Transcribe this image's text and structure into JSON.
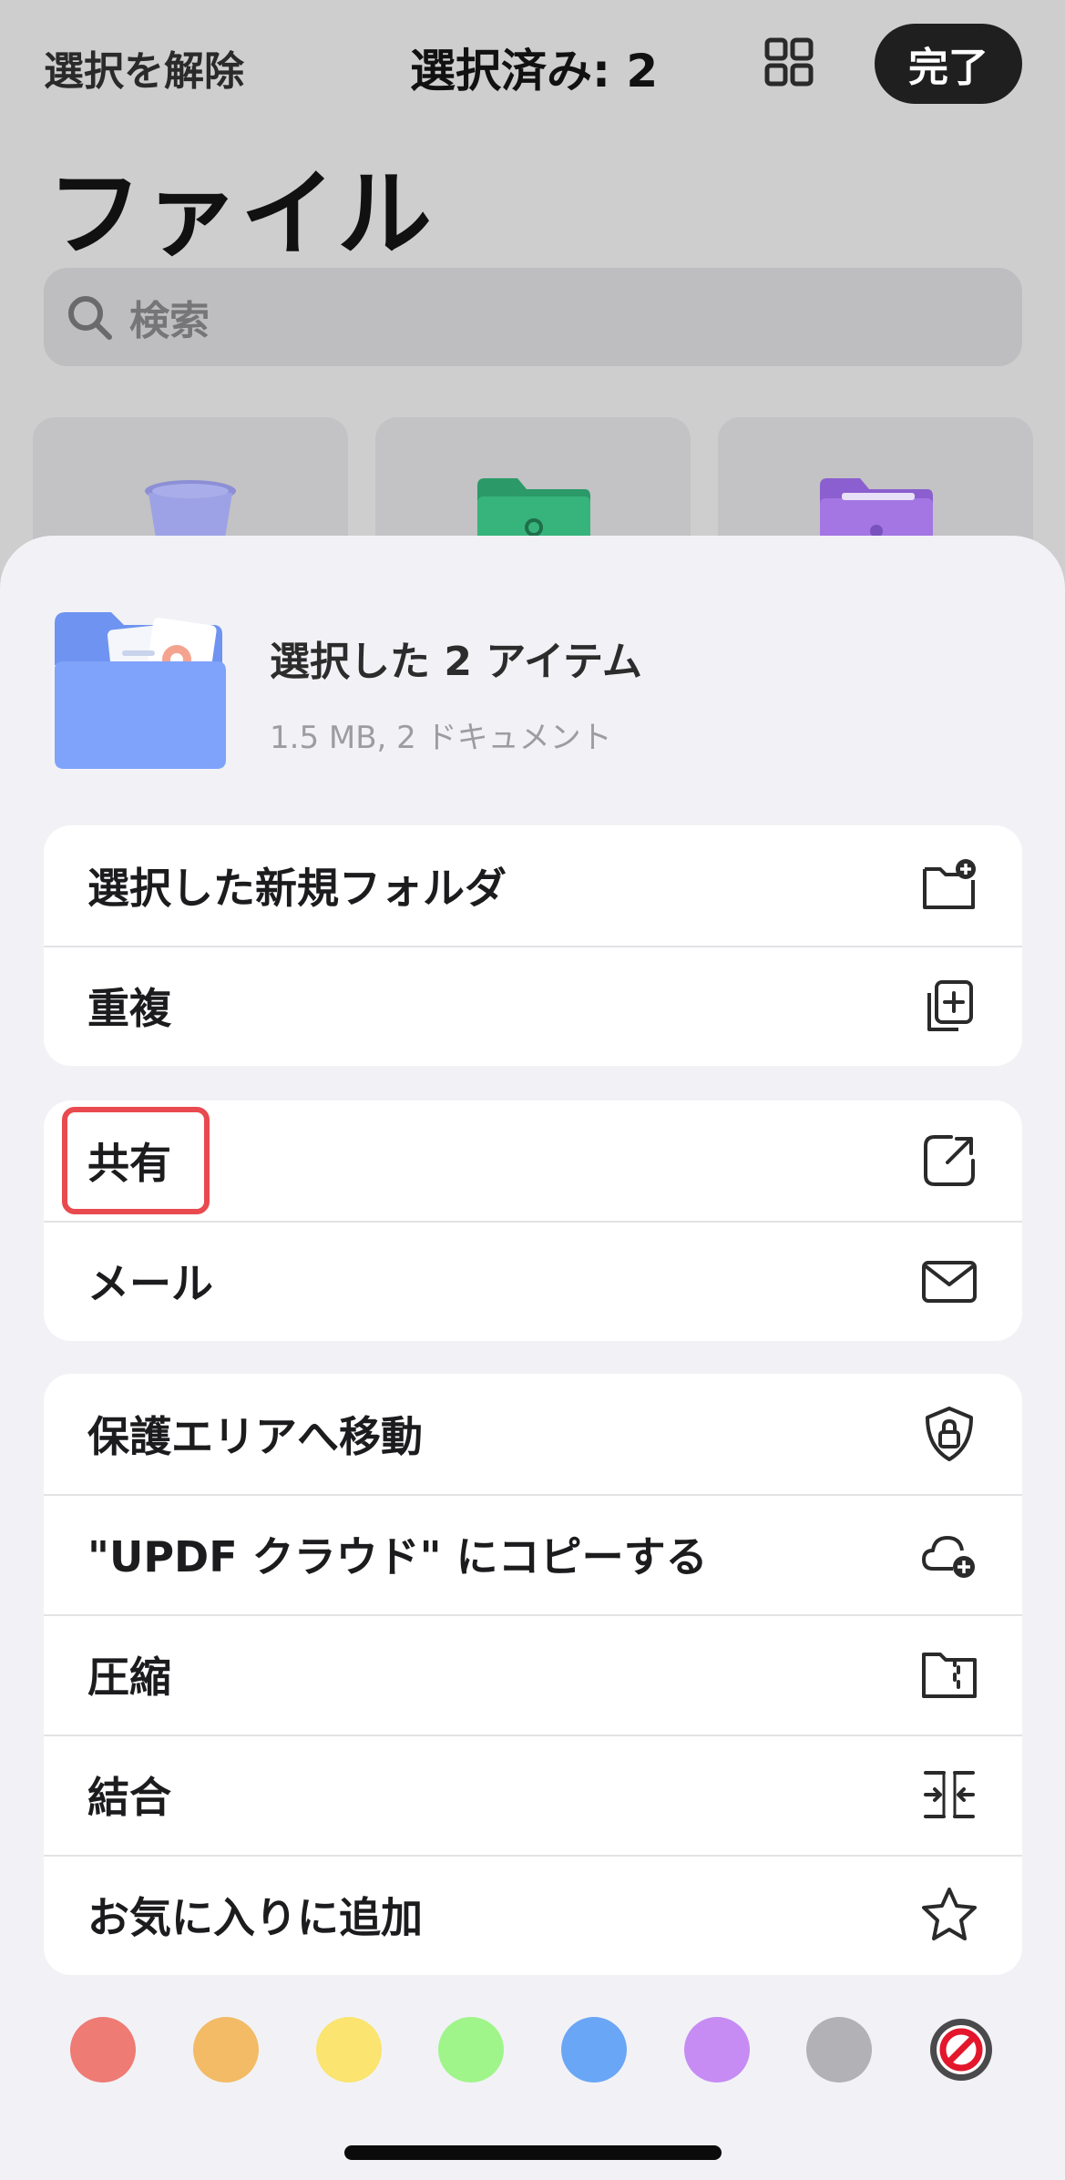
{
  "topbar": {
    "deselect_label": "選択を解除",
    "selection_count": "選択済み: 2",
    "done_label": "完了"
  },
  "page": {
    "title": "ファイル",
    "search_placeholder": "検索"
  },
  "sheet": {
    "header_title": "選択した 2 アイテム",
    "header_subtitle": "1.5 MB, 2 ドキュメント",
    "groups": [
      [
        {
          "label": "選択した新規フォルダ",
          "icon": "new-folder-icon"
        },
        {
          "label": "重複",
          "icon": "duplicate-icon"
        }
      ],
      [
        {
          "label": "共有",
          "icon": "share-icon"
        },
        {
          "label": "メール",
          "icon": "mail-icon"
        }
      ],
      [
        {
          "label": "保護エリアへ移動",
          "icon": "shield-lock-icon"
        },
        {
          "label": " \"UPDF クラウド\" にコピーする",
          "icon": "cloud-add-icon"
        },
        {
          "label": "圧縮",
          "icon": "zip-folder-icon"
        },
        {
          "label": "結合",
          "icon": "merge-icon"
        },
        {
          "label": "お気に入りに追加",
          "icon": "star-icon"
        }
      ]
    ],
    "color_tags": [
      "#ee7b74",
      "#f3bb66",
      "#fbe46f",
      "#9ff58a",
      "#6aa6f6",
      "#c68cf3",
      "#b2b1b6"
    ],
    "no_color_icon": "no-color-icon"
  }
}
